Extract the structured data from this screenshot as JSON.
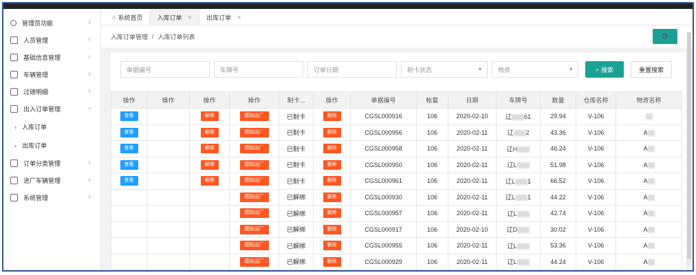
{
  "sidebar": {
    "items": [
      {
        "label": "管理员功能",
        "icon": "user-icon"
      },
      {
        "label": "人员管理",
        "icon": "doc-icon"
      },
      {
        "label": "基础信息管理",
        "icon": "doc-icon"
      },
      {
        "label": "车辆管理",
        "icon": "doc-icon"
      },
      {
        "label": "过磅明细",
        "icon": "doc-icon"
      },
      {
        "label": "出入订单管理",
        "icon": "doc-icon",
        "expanded": true
      }
    ],
    "sub_items": [
      {
        "label": "入库订单"
      },
      {
        "label": "出库订单"
      }
    ],
    "items_after": [
      {
        "label": "订单分类管理"
      },
      {
        "label": "进厂车辆管理"
      },
      {
        "label": "系统管理"
      }
    ]
  },
  "tabs": [
    {
      "label": "系统首页"
    },
    {
      "label": "入库订单"
    },
    {
      "label": "出库订单"
    }
  ],
  "breadcrumb": {
    "parent": "入库订单管理",
    "sep": "/",
    "current": "入库订单列表"
  },
  "search": {
    "order_no_placeholder": "单据编号",
    "plate_placeholder": "车牌号",
    "date_placeholder": "订单日期",
    "card_status_placeholder": "制卡状态",
    "warehouse_placeholder": "物资",
    "search_label": "搜索",
    "reset_label": "重置搜索"
  },
  "table": {
    "headers": [
      "操作",
      "操作",
      "操作",
      "操作",
      "制卡...",
      "操作",
      "单据编号",
      "帐套",
      "日期",
      "车牌号",
      "数量",
      "仓库名称",
      "物资名称"
    ],
    "btn_view": "查看",
    "btn_unbind": "解绑",
    "btn_simulate": "模拟出厂",
    "btn_delete": "删除",
    "rows": [
      {
        "view": true,
        "unbind": true,
        "status": "已制卡",
        "order": "CGSL000916",
        "set": "106",
        "date": "2020-02-10",
        "plate_prefix": "辽",
        "plate_suffix": "61",
        "qty": "29.94",
        "warehouse": "V-106",
        "material": ""
      },
      {
        "view": true,
        "unbind": true,
        "status": "已制卡",
        "order": "CGSL000956",
        "set": "106",
        "date": "2020-02-11",
        "plate_prefix": "辽",
        "plate_suffix": "2",
        "qty": "43.36",
        "warehouse": "V-106",
        "material": "A"
      },
      {
        "view": true,
        "unbind": true,
        "status": "已制卡",
        "order": "CGSL000958",
        "set": "106",
        "date": "2020-02-11",
        "plate_prefix": "辽H",
        "plate_suffix": "",
        "qty": "46.24",
        "warehouse": "V-106",
        "material": "A"
      },
      {
        "view": true,
        "unbind": true,
        "status": "已制卡",
        "order": "CGSL000950",
        "set": "106",
        "date": "2020-02-11",
        "plate_prefix": "辽L",
        "plate_suffix": "",
        "qty": "51.98",
        "warehouse": "V-106",
        "material": "A"
      },
      {
        "view": true,
        "unbind": true,
        "status": "已制卡",
        "order": "CGSL000961",
        "set": "106",
        "date": "2020-02-11",
        "plate_prefix": "辽L",
        "plate_suffix": "1",
        "qty": "66.52",
        "warehouse": "V-106",
        "material": "A"
      },
      {
        "view": false,
        "unbind": false,
        "status": "已解绑",
        "order": "CGSL000930",
        "set": "106",
        "date": "2020-02-11",
        "plate_prefix": "辽L",
        "plate_suffix": "1",
        "qty": "44.22",
        "warehouse": "V-106",
        "material": "A"
      },
      {
        "view": false,
        "unbind": false,
        "status": "已解绑",
        "order": "CGSL000957",
        "set": "106",
        "date": "2020-02-11",
        "plate_prefix": "辽L",
        "plate_suffix": "",
        "qty": "42.74",
        "warehouse": "V-106",
        "material": "A"
      },
      {
        "view": false,
        "unbind": false,
        "status": "已解绑",
        "order": "CGSL000917",
        "set": "106",
        "date": "2020-02-10",
        "plate_prefix": "辽D",
        "plate_suffix": "",
        "qty": "30.02",
        "warehouse": "V-106",
        "material": "A"
      },
      {
        "view": false,
        "unbind": false,
        "status": "已解绑",
        "order": "CGSL000955",
        "set": "106",
        "date": "2020-02-11",
        "plate_prefix": "辽L",
        "plate_suffix": "",
        "qty": "53.36",
        "warehouse": "V-106",
        "material": "A"
      },
      {
        "view": false,
        "unbind": false,
        "status": "已解绑",
        "order": "CGSL000929",
        "set": "106",
        "date": "2020-02-11",
        "plate_prefix": "辽L",
        "plate_suffix": "",
        "qty": "44.24",
        "warehouse": "V-106",
        "material": "A"
      }
    ]
  },
  "colors": {
    "accent": "#1aa094",
    "blue": "#1e9fff",
    "red": "#ff5722",
    "frame": "#2f5596"
  }
}
